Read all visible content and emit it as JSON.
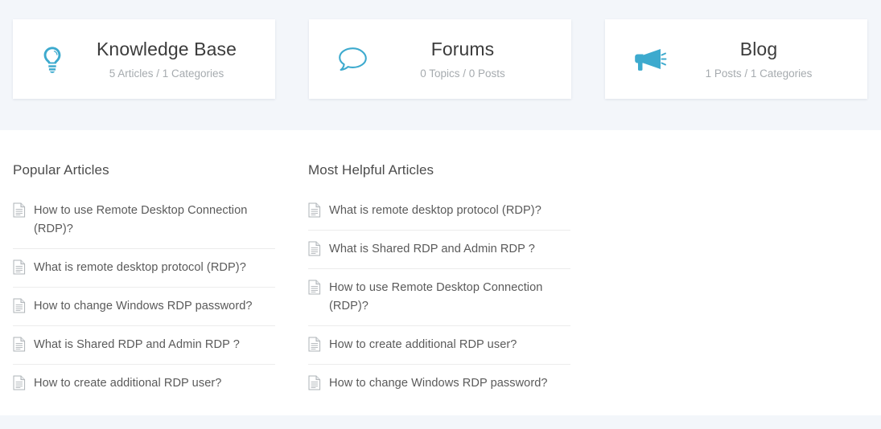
{
  "colors": {
    "accent": "#3daace",
    "band_background": "#f3f6fa",
    "page_background": "#ffffff",
    "card_background": "#ffffff",
    "title_text": "#3c3c3c",
    "subtitle_text": "#a6abaf",
    "heading_text": "#4c4c4c",
    "item_text": "#5a5a5a",
    "divider": "#ececec"
  },
  "stats": {
    "cards": [
      {
        "icon": "lightbulb-icon",
        "title": "Knowledge Base",
        "subtitle": "5 Articles / 1 Categories"
      },
      {
        "icon": "speech-bubble-icon",
        "title": "Forums",
        "subtitle": "0 Topics / 0 Posts"
      },
      {
        "icon": "megaphone-icon",
        "title": "Blog",
        "subtitle": "1 Posts / 1 Categories"
      }
    ]
  },
  "lists": {
    "popular": {
      "heading": "Popular Articles",
      "items": [
        {
          "icon": "document-icon",
          "label": "How to use Remote Desktop Connection (RDP)?"
        },
        {
          "icon": "document-icon",
          "label": "What is remote desktop protocol (RDP)?"
        },
        {
          "icon": "document-icon",
          "label": "How to change Windows RDP password?"
        },
        {
          "icon": "document-icon",
          "label": "What is Shared RDP and Admin RDP ?"
        },
        {
          "icon": "document-icon",
          "label": "How to create additional RDP user?"
        }
      ]
    },
    "most_helpful": {
      "heading": "Most Helpful Articles",
      "items": [
        {
          "icon": "document-icon",
          "label": "What is remote desktop protocol (RDP)?"
        },
        {
          "icon": "document-icon",
          "label": "What is Shared RDP and Admin RDP ?"
        },
        {
          "icon": "document-icon",
          "label": "How to use Remote Desktop Connection (RDP)?"
        },
        {
          "icon": "document-icon",
          "label": "How to create additional RDP user?"
        },
        {
          "icon": "document-icon",
          "label": "How to change Windows RDP password?"
        }
      ]
    }
  }
}
